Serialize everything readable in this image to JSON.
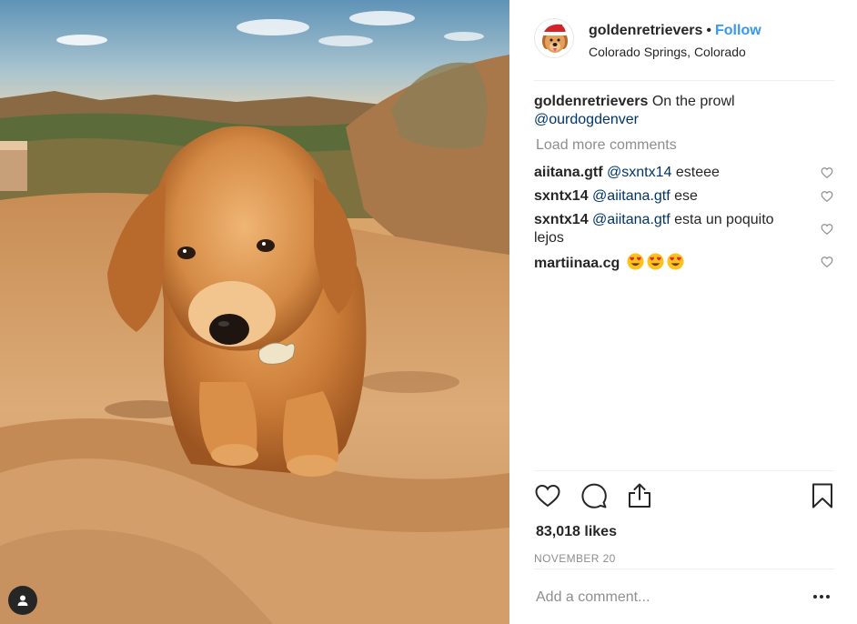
{
  "post": {
    "username": "goldenretrievers",
    "separator": "•",
    "follow_label": "Follow",
    "location": "Colorado Springs, Colorado",
    "caption_text": "On the prowl",
    "caption_mention": "@ourdogdenver"
  },
  "comments": {
    "load_more_label": "Load more comments",
    "items": [
      {
        "user": "aiitana.gtf",
        "mention": "@sxntx14",
        "text": "esteee"
      },
      {
        "user": "sxntx14",
        "mention": "@aiitana.gtf",
        "text": "ese"
      },
      {
        "user": "sxntx14",
        "mention": "@aiitana.gtf",
        "text": "esta un poquito lejos"
      },
      {
        "user": "martiinaa.cg",
        "emojis": [
          "heart-eyes-emoji",
          "heart-eyes-emoji",
          "heart-eyes-emoji"
        ]
      }
    ]
  },
  "stats": {
    "likes": "83,018 likes",
    "date": "NOVEMBER 20"
  },
  "compose": {
    "placeholder": "Add a comment..."
  },
  "icons": {
    "like": "heart-outline-icon",
    "comment": "speech-bubble-icon",
    "share": "share-upload-icon",
    "save": "bookmark-icon",
    "more": "ellipsis-icon",
    "user_tags": "user-tag-icon"
  },
  "colors": {
    "link_blue": "#3897f0",
    "mention": "#003569",
    "muted": "#8e8e8e",
    "text": "#262626"
  }
}
